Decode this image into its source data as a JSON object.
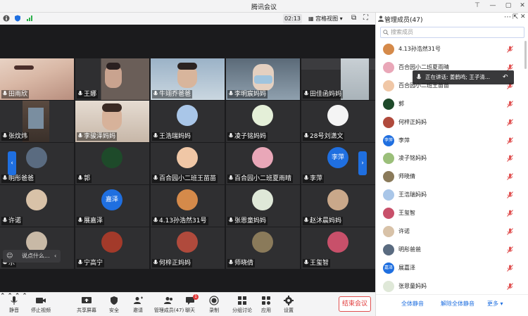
{
  "window": {
    "title": "腾讯会议"
  },
  "topbar": {
    "timer": "02:13",
    "view_label": "宫格视图"
  },
  "colors": {
    "accent": "#1f6fe0",
    "end": "#e03a3a",
    "muted_mic": "#e05050"
  },
  "tiles": [
    {
      "name": "田雨欣",
      "kind": "video",
      "feed": "face"
    },
    {
      "name": "王娜",
      "kind": "video",
      "feed": "room"
    },
    {
      "name": "牛翊乔爸爸",
      "kind": "video",
      "feed": "kid"
    },
    {
      "name": "李明宸妈妈",
      "kind": "video",
      "feed": "mask"
    },
    {
      "name": "田佳函妈妈",
      "kind": "video",
      "feed": "wall"
    },
    {
      "name": "张炆炜",
      "kind": "video",
      "feed": "door"
    },
    {
      "name": "李骏泽妈妈",
      "kind": "video",
      "feed": "kid2"
    },
    {
      "name": "王浩瑞妈妈",
      "kind": "avatar",
      "avatar_color": "#a9c6e8"
    },
    {
      "name": "凌子铭妈妈",
      "kind": "avatar",
      "avatar_color": "#e4efd8"
    },
    {
      "name": "28号刘潇文",
      "kind": "avatar",
      "avatar_color": "#f4f4f4"
    },
    {
      "name": "明彤爸爸",
      "kind": "avatar",
      "avatar_color": "#5a6b80"
    },
    {
      "name": "郭",
      "kind": "avatar",
      "avatar_color": "#1e4a2a"
    },
    {
      "name": "百合园小二班王苗苗",
      "kind": "avatar",
      "avatar_color": "#f0c7a6"
    },
    {
      "name": "百合园小二班夏雨晴",
      "kind": "avatar",
      "avatar_color": "#e9a7b8"
    },
    {
      "name": "李萍",
      "kind": "avatar_text",
      "avatar_text": "李萍"
    },
    {
      "name": "许诺",
      "kind": "avatar",
      "avatar_color": "#d8c2a8"
    },
    {
      "name": "展嘉泽",
      "kind": "avatar_text",
      "avatar_text": "嘉泽"
    },
    {
      "name": "4.13孙浩然31号",
      "kind": "avatar",
      "avatar_color": "#d58a4a"
    },
    {
      "name": "张恩童妈妈",
      "kind": "avatar",
      "avatar_color": "#dfe8d8"
    },
    {
      "name": "赵沐晨妈妈",
      "kind": "avatar",
      "avatar_color": "#c9a88a"
    },
    {
      "name": "乐",
      "kind": "avatar",
      "avatar_color": "#c8b9a6"
    },
    {
      "name": "宁高宁",
      "kind": "avatar",
      "avatar_color": "#a33a2a"
    },
    {
      "name": "何梓正妈妈",
      "kind": "avatar",
      "avatar_color": "#b04a3c"
    },
    {
      "name": "师晓倩",
      "kind": "avatar",
      "avatar_color": "#8a7a5a"
    },
    {
      "name": "王玺智",
      "kind": "avatar",
      "avatar_color": "#c8506a"
    }
  ],
  "chat": {
    "placeholder": "说点什么..."
  },
  "bottombar": {
    "mute": "静音",
    "stop_video": "停止视频",
    "share": "共享屏幕",
    "security": "安全",
    "invite": "邀请",
    "members": "管理成员(47)",
    "chat": "聊天",
    "chat_badge": "1",
    "record": "录制",
    "breakout": "分组讨论",
    "apps": "应用",
    "settings": "设置",
    "end": "结束会议"
  },
  "panel": {
    "title": "管理成员(47)",
    "search_placeholder": "搜索成员",
    "members": [
      {
        "name": "4.13孙浩然31号",
        "avatar_color": "#d58a4a"
      },
      {
        "name": "百合园小二班夏雨晴",
        "avatar_color": "#e9a7b8"
      },
      {
        "name": "百合园小二班王苗苗",
        "avatar_color": "#f0c7a6"
      },
      {
        "name": "郭",
        "avatar_color": "#1e4a2a"
      },
      {
        "name": "何梓正妈妈",
        "avatar_color": "#b04a3c"
      },
      {
        "name": "李萍",
        "avatar_text": "李萍"
      },
      {
        "name": "凌子铭妈妈",
        "avatar_color": "#9bbf7a"
      },
      {
        "name": "师晓倩",
        "avatar_color": "#8a7a5a"
      },
      {
        "name": "王浩瑞妈妈",
        "avatar_color": "#a9c6e8"
      },
      {
        "name": "王玺智",
        "avatar_color": "#c8506a"
      },
      {
        "name": "许诺",
        "avatar_color": "#d8c2a8"
      },
      {
        "name": "明彤爸爸",
        "avatar_color": "#5a6b80"
      },
      {
        "name": "展嘉泽",
        "avatar_text": "嘉泽"
      },
      {
        "name": "张恩童妈妈",
        "avatar_color": "#dfe8d8"
      }
    ],
    "mute_all": "全体静音",
    "unmute_all": "解除全体静音",
    "more": "更多"
  },
  "speaking": {
    "label": "正在讲话: 姜鹤鸣; 王子清..."
  }
}
